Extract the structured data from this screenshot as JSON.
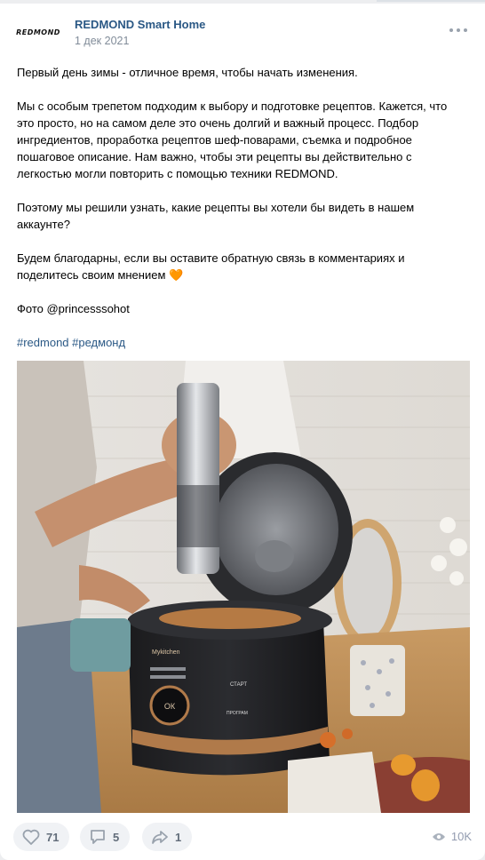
{
  "post": {
    "author": "REDMOND Smart Home",
    "date": "1 дек 2021",
    "logo_text": "REDMOND",
    "paragraphs": [
      "Первый день зимы - отличное время, чтобы начать изменения.",
      "Мы с особым трепетом подходим к выбору и подготовке рецептов. Кажется, что это просто, но на самом деле это очень долгий и важный процесс. Подбор ингредиентов, проработка рецептов шеф-поварами, съемка и подробное пошаговое описание. Нам важно, чтобы эти рецепты вы действительно с легкостью могли повторить с помощью техники REDMOND.",
      "Поэтому мы решили узнать, какие рецепты вы хотели бы видеть в нашем аккаунте?",
      "Будем благодарны, если вы оставите обратную связь в комментариях и поделитесь своим мнением",
      "Фото @princesssohot"
    ],
    "emoji": "🧡",
    "hashtags": "#redmond #редмонд"
  },
  "photo": {
    "cooker_brand": "Mykitchen",
    "cooker_buttons": [
      "СТАРТ",
      "ПРОГРАМ",
      "ОК"
    ]
  },
  "actions": {
    "likes": "71",
    "comments": "5",
    "shares": "1",
    "views": "10K"
  },
  "colors": {
    "link": "#2a5885",
    "muted": "#818c99",
    "action_bg": "#f0f2f5",
    "action_icon": "#99a2ad"
  }
}
